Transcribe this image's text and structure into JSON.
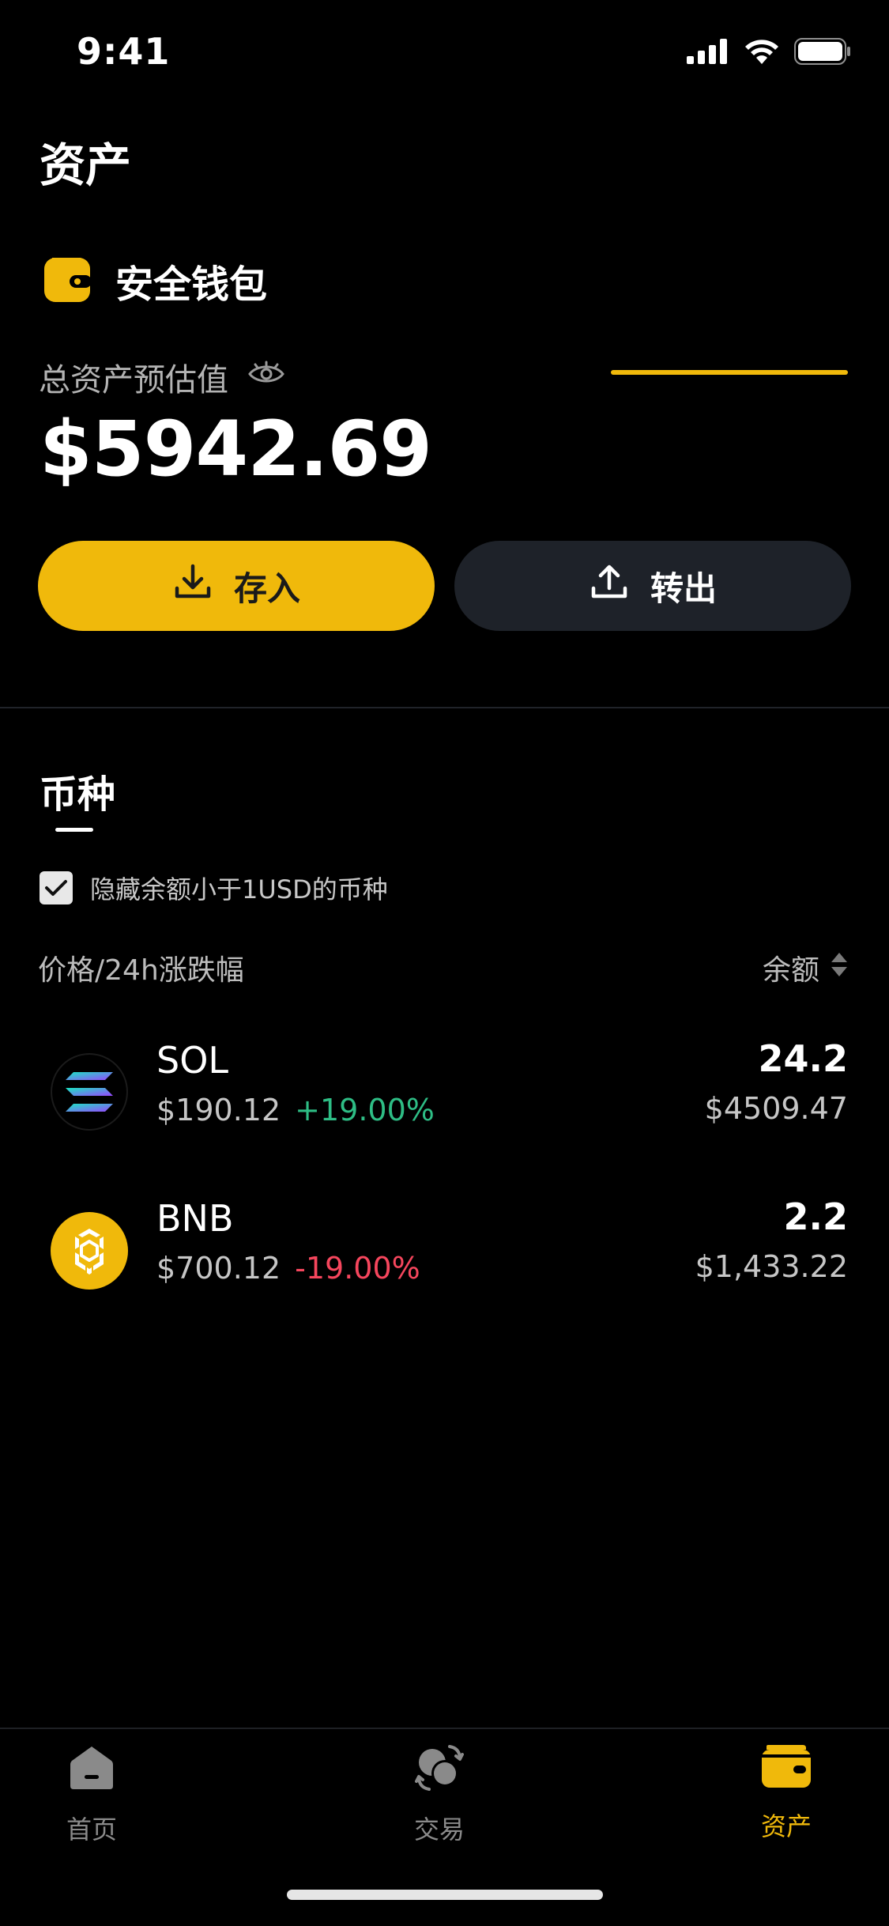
{
  "status_bar": {
    "time": "9:41"
  },
  "header": {
    "title": "资产"
  },
  "wallet": {
    "name": "安全钱包",
    "total_label": "总资产预估值",
    "total_value": "$5942.69"
  },
  "actions": {
    "deposit_label": "存入",
    "withdraw_label": "转出"
  },
  "coins_section": {
    "title": "币种",
    "hide_small_label": "隐藏余额小于1USD的币种",
    "hide_small_checked": true,
    "column_left": "价格/24h涨跌幅",
    "column_right": "余额"
  },
  "coins": [
    {
      "symbol": "SOL",
      "price": "$190.12",
      "change": "+19.00%",
      "amount": "24.2",
      "value": "$4509.47"
    },
    {
      "symbol": "BNB",
      "price": "$700.12",
      "change": "-19.00%",
      "amount": "2.2",
      "value": "$1,433.22"
    }
  ],
  "tab_bar": {
    "tabs": [
      {
        "label": "首页",
        "icon": "home-icon"
      },
      {
        "label": "交易",
        "icon": "trade-icon"
      },
      {
        "label": "资产",
        "icon": "wallet-icon"
      }
    ],
    "active_index": 2
  },
  "colors": {
    "accent": "#f0b90b",
    "up": "#2ebd85",
    "down": "#f6465d",
    "background": "#000000"
  }
}
